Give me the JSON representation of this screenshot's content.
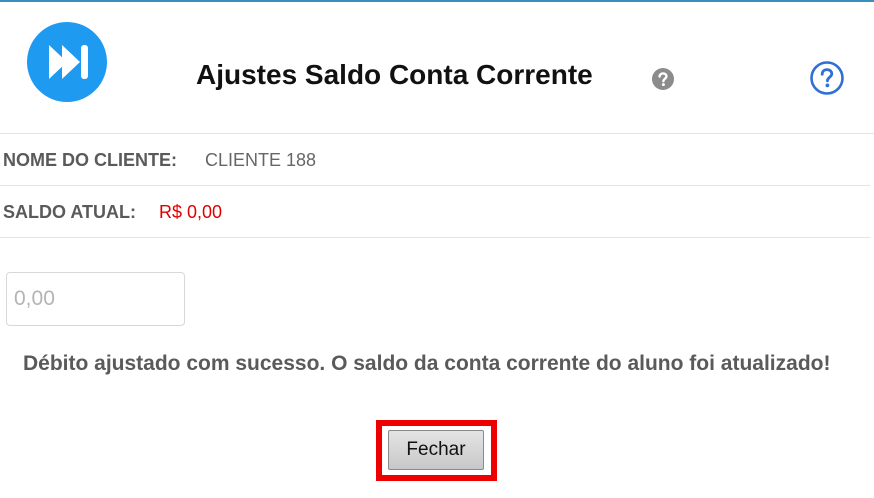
{
  "header": {
    "title": "Ajustes Saldo Conta Corrente",
    "logo_icon": "fast-forward-icon",
    "title_help_icon": "question-circle-icon",
    "help_icon": "question-circle-outline-icon",
    "brand_color": "#1e9af0",
    "help_color": "#2f6fd6"
  },
  "client": {
    "label": "NOME DO CLIENTE:",
    "value": "CLIENTE 188"
  },
  "balance": {
    "label": "SALDO ATUAL:",
    "value": "R$ 0,00",
    "value_color": "#e00000"
  },
  "amount_input": {
    "value": "",
    "placeholder": "0,00"
  },
  "message": "Débito ajustado com sucesso. O saldo da conta corrente do aluno foi atualizado!",
  "close_button": {
    "label": "Fechar",
    "highlight_color": "#ee0000"
  }
}
